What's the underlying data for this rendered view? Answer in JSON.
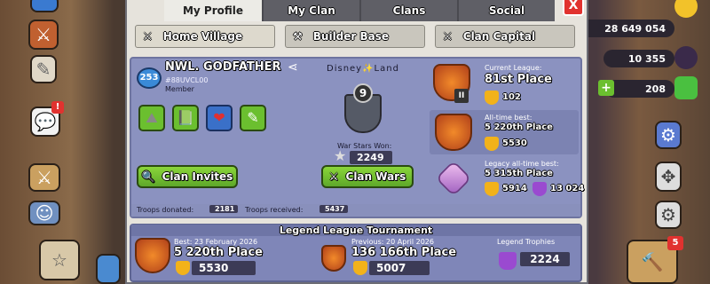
{
  "tabs": [
    {
      "label": "My Profile",
      "active": true
    },
    {
      "label": "My Clan",
      "active": false
    },
    {
      "label": "Clans",
      "active": false
    },
    {
      "label": "Social",
      "active": false
    }
  ],
  "close_label": "X",
  "subtabs": [
    {
      "label": "Home Village",
      "active": true
    },
    {
      "label": "Builder Base",
      "active": false
    },
    {
      "label": "Clan Capital",
      "active": false
    }
  ],
  "resources": {
    "gold": "28 649 054",
    "dark_elixir": "10 355",
    "gems": "208"
  },
  "profile": {
    "level": "253",
    "name": "NWL. GODFATHER",
    "tag": "#88UVCL00",
    "role": "Member",
    "clan_name": "Disney✨Land",
    "clan_level": "9",
    "war_stars_label": "War Stars Won:",
    "war_stars": "2249",
    "clan_invites_label": "Clan Invites",
    "clan_wars_label": "Clan Wars",
    "troops_donated_label": "Troops donated:",
    "troops_donated": "2181",
    "troops_received_label": "Troops received:",
    "troops_received": "5437"
  },
  "league": {
    "current_label": "Current League:",
    "current_place": "81st Place",
    "current_trophies": "102",
    "current_badge": "II",
    "alltime_label": "All-time best:",
    "alltime_place": "5 220th Place",
    "alltime_trophies": "5530",
    "legacy_label": "Legacy all-time best:",
    "legacy_place": "5 315th Place",
    "legacy_trophies": "5914",
    "legacy_purple": "13 024"
  },
  "tournament": {
    "title": "Legend League Tournament",
    "best_label": "Best: 23 February 2026",
    "best_place": "5 220th Place",
    "best_trophies": "5530",
    "prev_label": "Previous: 20 April 2026",
    "prev_place": "136 166th Place",
    "prev_trophies": "5007",
    "legend_label": "Legend Trophies",
    "legend_trophies": "2224"
  },
  "right_badge": "5",
  "colors": {
    "green": "#6bbf2f",
    "red": "#e1322f",
    "panel": "#8b92c0"
  }
}
